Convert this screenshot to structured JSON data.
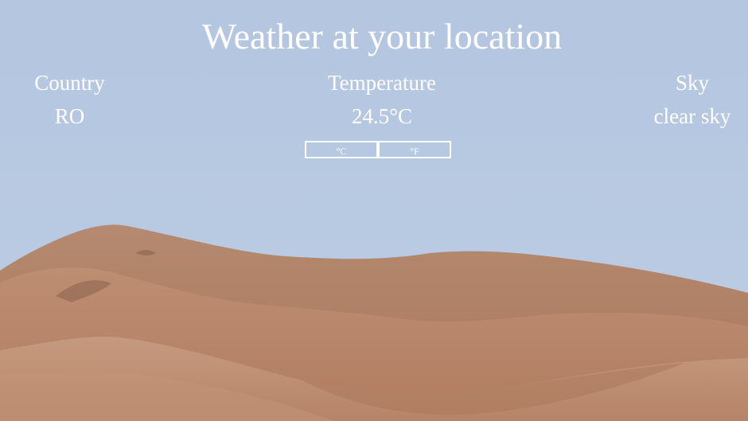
{
  "header": {
    "title": "Weather at your location"
  },
  "weather": {
    "country_label": "Country",
    "country_value": "RO",
    "temperature_label": "Temperature",
    "temperature_value": "24.5°C",
    "sky_label": "Sky",
    "sky_value": "clear sky"
  },
  "unit_toggle": {
    "celsius_label": "°C",
    "fahrenheit_label": "°F"
  },
  "background": {
    "image": "desert-dunes",
    "sky_color": "#b5c7df",
    "sand_color": "#b8866a"
  }
}
